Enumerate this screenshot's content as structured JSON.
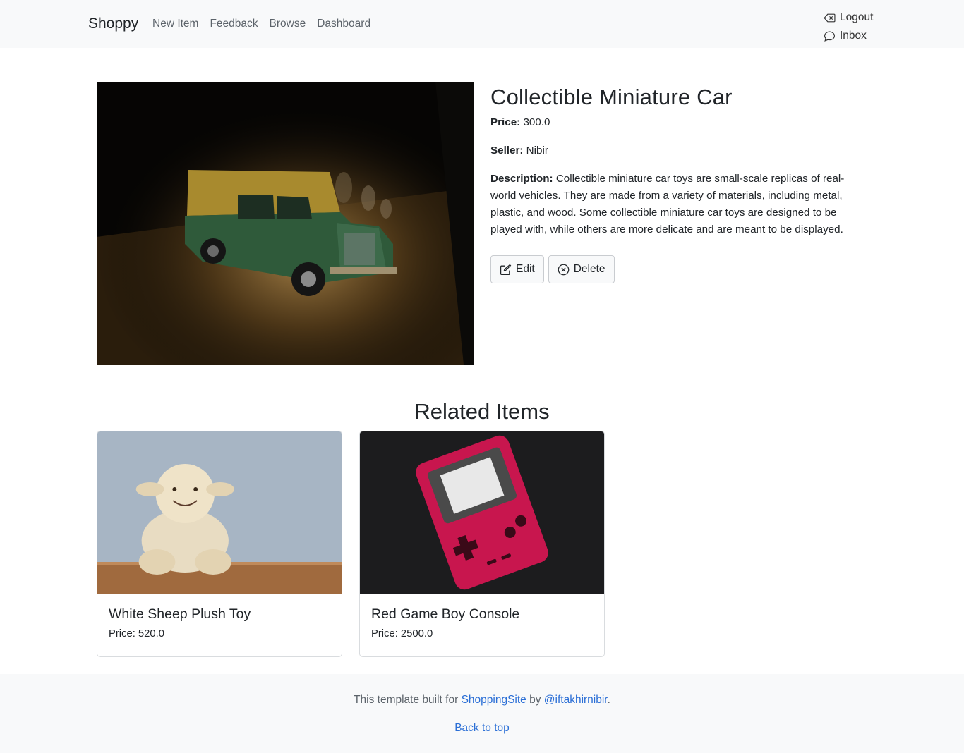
{
  "navbar": {
    "brand": "Shoppy",
    "links": [
      "New Item",
      "Feedback",
      "Browse",
      "Dashboard"
    ],
    "logout_label": "Logout",
    "inbox_label": "Inbox"
  },
  "product": {
    "title": "Collectible Miniature Car",
    "price_label": "Price:",
    "price": "300.0",
    "seller_label": "Seller:",
    "seller": "Nibir",
    "description_label": "Description:",
    "description": "Collectible miniature car toys are small-scale replicas of real-world vehicles. They are made from a variety of materials, including metal, plastic, and wood. Some collectible miniature car toys are designed to be played with, while others are more delicate and are meant to be displayed.",
    "edit_label": "Edit",
    "delete_label": "Delete"
  },
  "related": {
    "heading": "Related Items",
    "items": [
      {
        "title": "White Sheep Plush Toy",
        "price": "Price: 520.0"
      },
      {
        "title": "Red Game Boy Console",
        "price": "Price: 2500.0"
      }
    ]
  },
  "footer": {
    "text_prefix": "This template built for",
    "site_link": "ShoppingSite",
    "by": "by",
    "author_link": "@iftakhirnibir",
    "period": ".",
    "back_to_top": "Back to top"
  },
  "colors": {
    "navbar_bg": "#f8f9fa",
    "link": "#2b6fd6",
    "text": "#212529"
  }
}
